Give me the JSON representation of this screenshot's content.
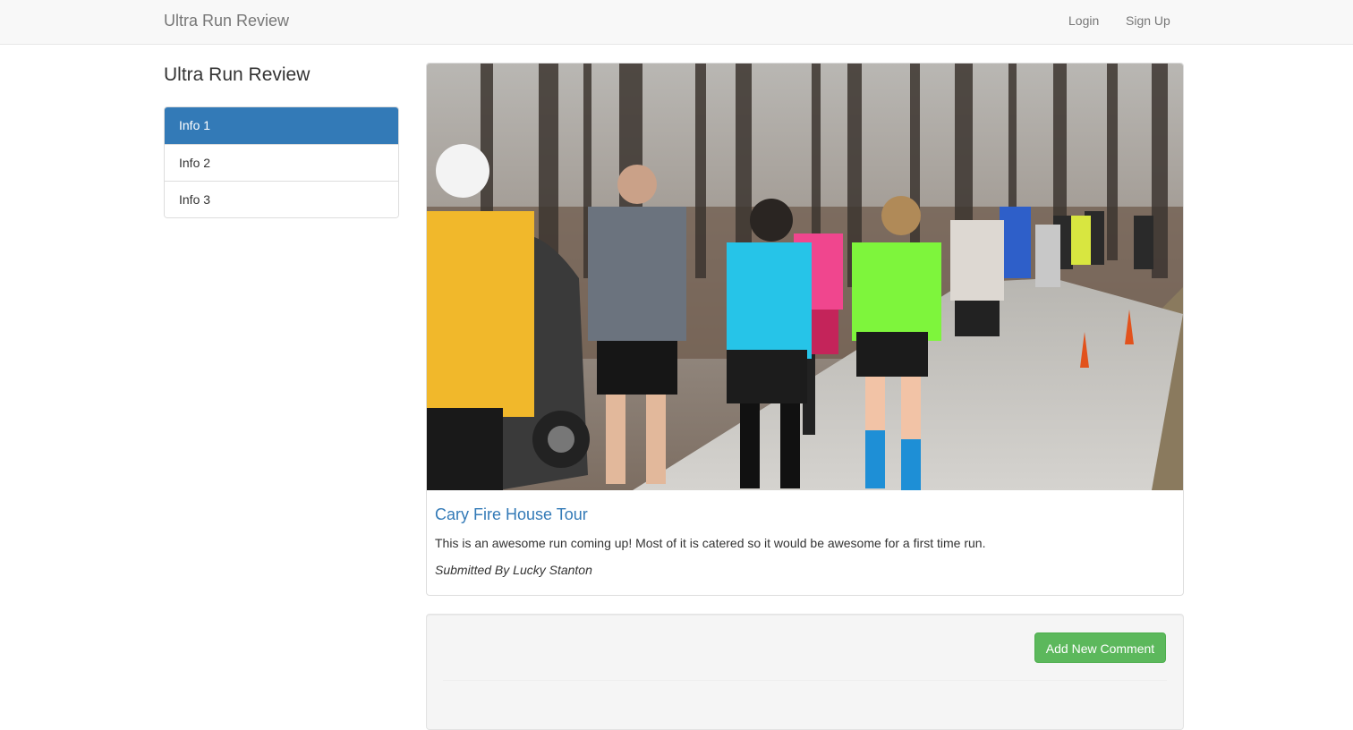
{
  "navbar": {
    "brand": "Ultra Run Review",
    "links": [
      "Login",
      "Sign Up"
    ]
  },
  "sidebar": {
    "title": "Ultra Run Review",
    "items": [
      {
        "label": "Info 1",
        "active": true
      },
      {
        "label": "Info 2",
        "active": false
      },
      {
        "label": "Info 3",
        "active": false
      }
    ]
  },
  "post": {
    "image": "runners-on-trail-photo",
    "title": "Cary Fire House Tour",
    "description": "This is an awesome run coming up! Most of it is catered so it would be awesome for a first time run.",
    "author": "Submitted By Lucky Stanton"
  },
  "comments": {
    "add_label": "Add New Comment"
  },
  "colors": {
    "primary": "#337ab7",
    "success": "#5cb85c",
    "navbar_bg": "#f8f8f8"
  }
}
